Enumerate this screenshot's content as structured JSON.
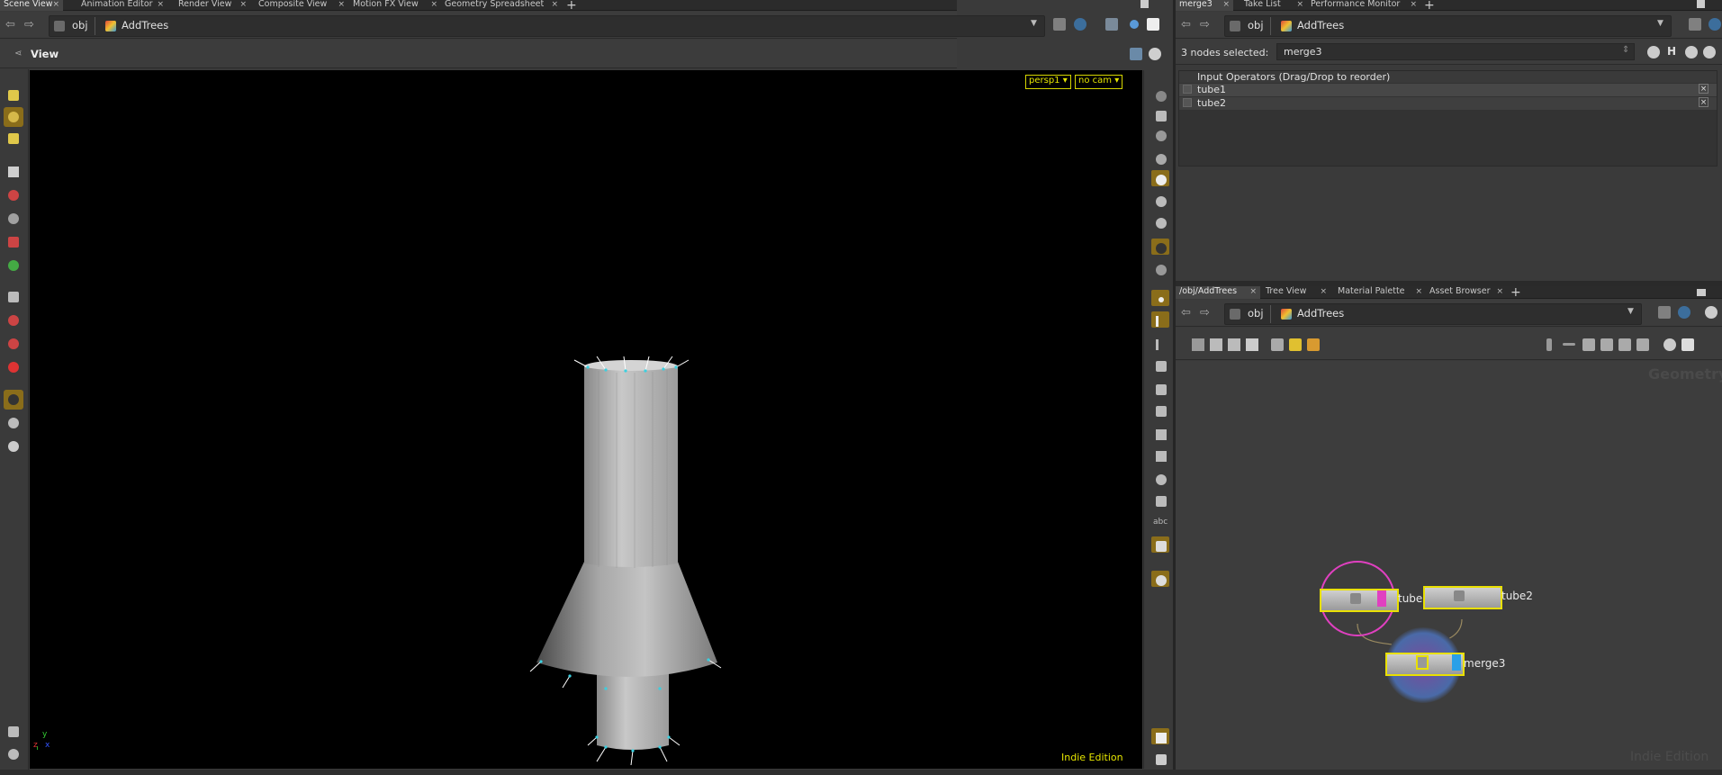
{
  "left_tabs": [
    {
      "label": "Scene View",
      "active": true
    },
    {
      "label": "Animation Editor"
    },
    {
      "label": "Render View"
    },
    {
      "label": "Composite View"
    },
    {
      "label": "Motion FX View"
    },
    {
      "label": "Geometry Spreadsheet"
    }
  ],
  "left_path": {
    "root": "obj",
    "node": "AddTrees"
  },
  "view_header": {
    "title": "View"
  },
  "viewport": {
    "camera_button": "persp1",
    "cam_button": "no cam",
    "watermark": "Indie Edition",
    "axis_y": "y",
    "axis_x": "x",
    "axis_z": "z"
  },
  "param_tabs": [
    {
      "label": "merge3",
      "active": true
    },
    {
      "label": "Take List"
    },
    {
      "label": "Performance Monitor"
    }
  ],
  "param_path": {
    "root": "obj",
    "node": "AddTrees"
  },
  "param_header": {
    "selection_label": "3 nodes selected:",
    "node_name": "merge3"
  },
  "input_operators": {
    "header": "Input Operators (Drag/Drop to reorder)",
    "items": [
      "tube1",
      "tube2"
    ]
  },
  "net_tabs": [
    {
      "label": "/obj/AddTrees",
      "active": true
    },
    {
      "label": "Tree View"
    },
    {
      "label": "Material Palette"
    },
    {
      "label": "Asset Browser"
    }
  ],
  "net_path": {
    "root": "obj",
    "node": "AddTrees"
  },
  "network": {
    "context_label": "Geometry",
    "watermark": "Indie Edition",
    "nodes": [
      {
        "name": "tube",
        "display_flag": true
      },
      {
        "name": "tube2"
      },
      {
        "name": "merge3",
        "selected": true
      }
    ]
  },
  "colors": {
    "accent_yellow": "#e9e000",
    "flag_magenta": "#e040c0",
    "flag_blue": "#2aa0e8",
    "tool_active": "#8a6d1a"
  }
}
